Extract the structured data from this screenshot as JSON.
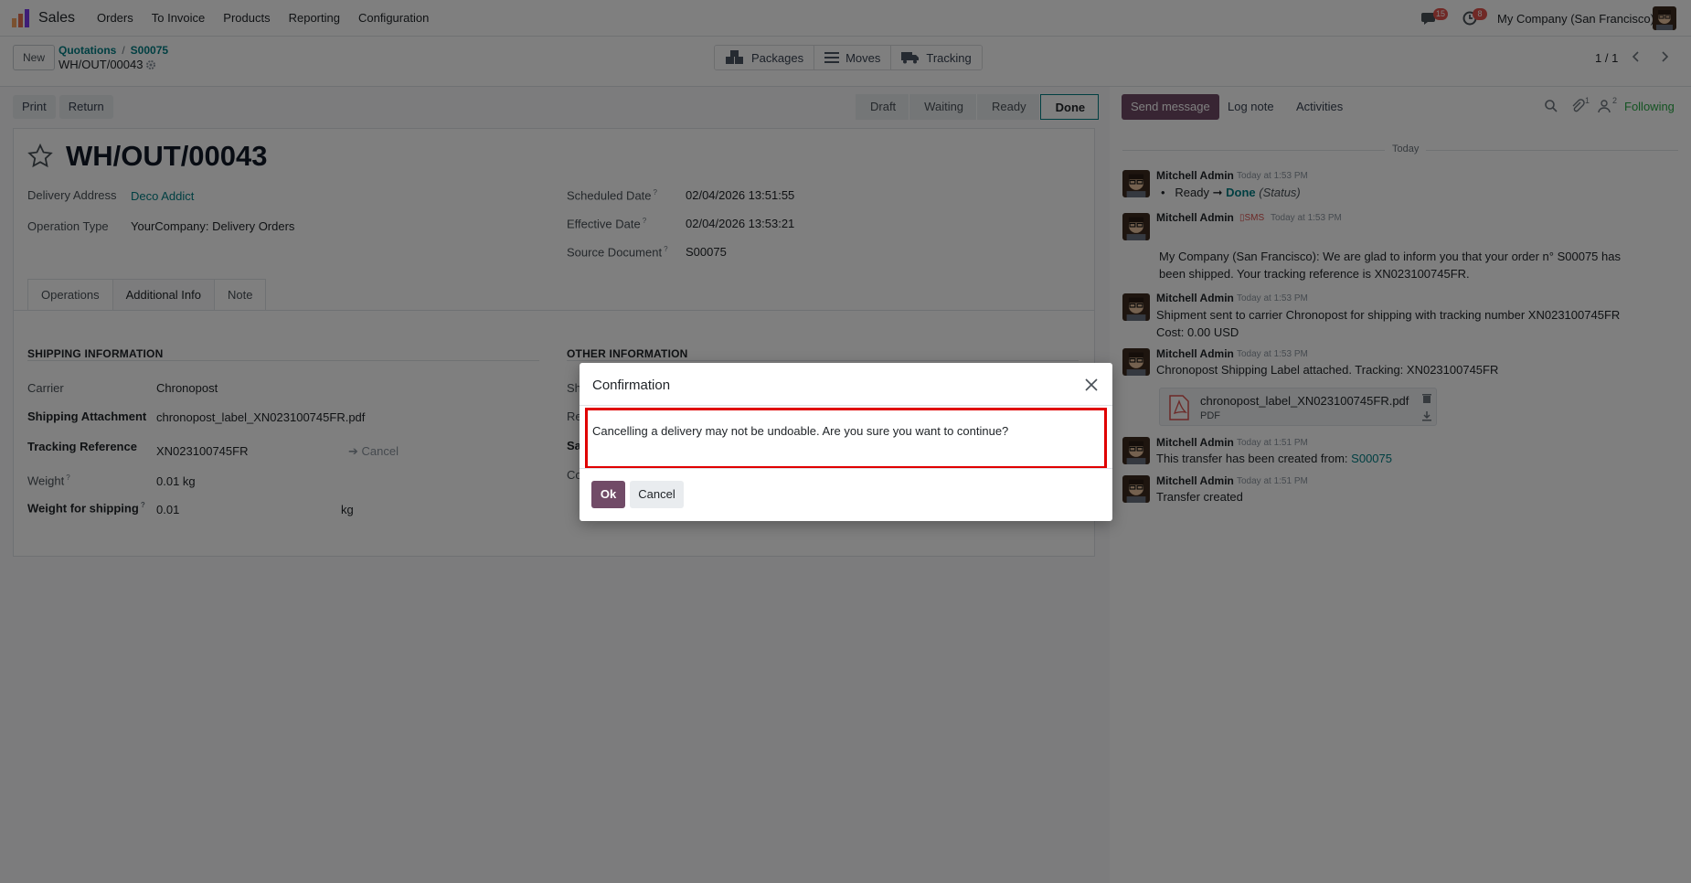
{
  "topnav": {
    "app_name": "Sales",
    "menu": [
      "Orders",
      "To Invoice",
      "Products",
      "Reporting",
      "Configuration"
    ],
    "messages_badge": "15",
    "activities_badge": "8",
    "company": "My Company (San Francisco)"
  },
  "control_panel": {
    "new_label": "New",
    "breadcrumb": [
      "Quotations",
      "S00075"
    ],
    "breadcrumb_sep": "/",
    "record_name": "WH/OUT/00043",
    "smart_buttons": [
      "Packages",
      "Moves",
      "Tracking"
    ],
    "pager": "1 / 1"
  },
  "statusbar": {
    "buttons": [
      "Print",
      "Return"
    ],
    "stages": [
      "Draft",
      "Waiting",
      "Ready",
      "Done"
    ],
    "active_stage": "Done"
  },
  "form": {
    "title": "WH/OUT/00043",
    "delivery_address_label": "Delivery Address",
    "delivery_address_value": "Deco Addict",
    "operation_type_label": "Operation Type",
    "operation_type_value": "YourCompany: Delivery Orders",
    "scheduled_date_label": "Scheduled Date",
    "scheduled_date_value": "02/04/2026 13:51:55",
    "effective_date_label": "Effective Date",
    "effective_date_value": "02/04/2026 13:53:21",
    "source_document_label": "Source Document",
    "source_document_value": "S00075",
    "tooltip_mark": "?",
    "tabs": [
      "Operations",
      "Additional Info",
      "Note"
    ],
    "active_tab": "Additional Info",
    "shipping_section": "SHIPPING INFORMATION",
    "other_section": "OTHER INFORMATION",
    "carrier_label": "Carrier",
    "carrier_value": "Chronopost",
    "shipping_attachment_label": "Shipping Attachment",
    "shipping_attachment_value": "chronopost_label_XN023100745FR.pdf",
    "tracking_reference_label": "Tracking Reference",
    "tracking_reference_value": "XN023100745FR",
    "cancel_link": "Cancel",
    "weight_label": "Weight",
    "weight_value": "0.01 kg",
    "weight_shipping_label": "Weight for shipping",
    "weight_shipping_value": "0.01",
    "weight_shipping_unit": "kg",
    "other_partial_labels": [
      "Sh",
      "Re",
      "Sa",
      "Co"
    ]
  },
  "chatter": {
    "send_message": "Send message",
    "log_note": "Log note",
    "activities": "Activities",
    "attachments_count": "1",
    "followers_count": "2",
    "following": "Following",
    "today": "Today",
    "messages": [
      {
        "author": "Mitchell Admin",
        "time": "Today at 1:53 PM",
        "status_from": "Ready",
        "status_to": "Done",
        "status_field": "(Status)"
      },
      {
        "author": "Mitchell Admin",
        "sms": "SMS",
        "time": "Today at 1:53 PM",
        "text": "My Company (San Francisco): We are glad to inform you that your order n° S00075 has been shipped. Your tracking reference is XN023100745FR."
      },
      {
        "author": "Mitchell Admin",
        "time": "Today at 1:53 PM",
        "text": "Shipment sent to carrier Chronopost for shipping with tracking number XN023100745FR",
        "text2": "Cost: 0.00 USD"
      },
      {
        "author": "Mitchell Admin",
        "time": "Today at 1:53 PM",
        "text": "Chronopost Shipping Label attached. Tracking: XN023100745FR",
        "attachment_name": "chronopost_label_XN023100745FR.pdf",
        "attachment_type": "PDF"
      },
      {
        "author": "Mitchell Admin",
        "time": "Today at 1:51 PM",
        "text": "This transfer has been created from:",
        "link": "S00075"
      },
      {
        "author": "Mitchell Admin",
        "time": "Today at 1:51 PM",
        "text": "Transfer created"
      }
    ]
  },
  "dialog": {
    "title": "Confirmation",
    "message": "Cancelling a delivery may not be undoable. Are you sure you want to continue?",
    "ok_label": "Ok",
    "cancel_label": "Cancel"
  },
  "colors": {
    "brand": "#714b67",
    "link": "#017e84",
    "highlight": "#e00000",
    "badge": "#e0524d"
  }
}
